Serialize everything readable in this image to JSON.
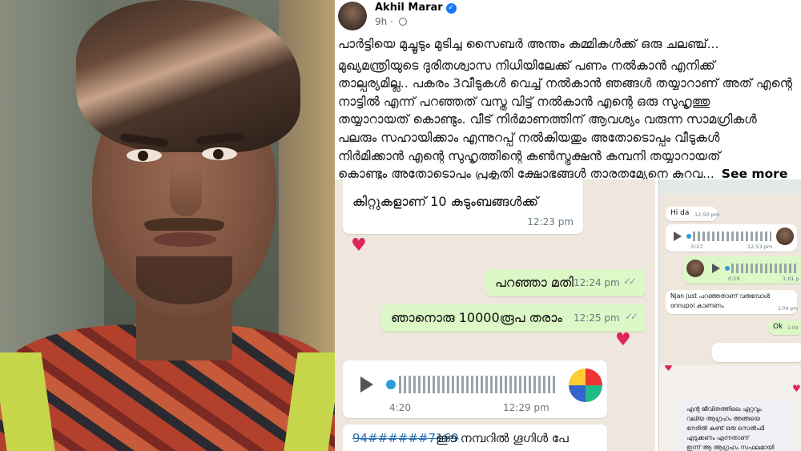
{
  "post": {
    "author": "Akhil Marar",
    "time": "9h",
    "see_more": "See more",
    "lines": [
      "പാർട്ടിയെ മുച്ചൂടും മുടിച്ച സൈബർ അന്തം കമ്മികൾക്ക് ഒരു ചലഞ്ച്...",
      "മുഖ്യമന്ത്രിയുടെ ദുരിതശ്വാസ നിധിയിലേക്ക് പണം നൽകാൻ എനിക്ക്",
      "താല്പര്യമില്ല.. പകരം 3വീടുകൾ വെച്ച് നൽകാൻ ഞങ്ങൾ തയ്യാറാണ് അത് എന്റെ",
      "നാട്ടിൽ എന്ന് പറഞ്ഞത് വസ്തു വിട്ട് നൽകാൻ എന്റെ ഒരു സുഹൃത്തു",
      "തയ്യാറായത് കൊണ്ടും. വീട് നിർമാണത്തിന് ആവശ്യം വരുന്ന സാമഗ്രികൾ",
      "പലരും സഹായിക്കാം എന്നുറപ്പ് നൽകിയതും അതോടൊപ്പം വീടുകൾ",
      "നിർമിക്കാൻ എന്റെ സുഹൃത്തിന്റെ കൺസ്ട്രക്ഷൻ കമ്പനി തയ്യാറായത്",
      "കൊണ്ടും അതോടൊപ്പം പ്രകൃതി ക്ഷോഭങ്ങൾ താരതമ്യേനെ കുറവ..."
    ]
  },
  "chat1": {
    "msg1": "കിറ്റുകളാണ് 10 കുടുംബങ്ങൾക്ക്",
    "msg1_time": "12:23 pm",
    "msg2": "പറഞ്ഞാ മതി",
    "msg2_time": "12:24 pm",
    "msg3": "ഞാനൊരു 10000രൂപ തരാം",
    "msg3_time": "12:25 pm",
    "voice_duration": "4:20",
    "voice_time": "12:29 pm",
    "msg4_number": "94######7169",
    "msg4": "ഈ നമ്പറിൽ ഗൂഗിൾ പേ",
    "ticks": "✓✓",
    "heart": "♥"
  },
  "chat2": {
    "msg1": "Hi da",
    "msg1_time": "12:50 pm",
    "voice1_duration": "0:27",
    "voice1_time": "12:53 pm",
    "voice2_duration": "0:19",
    "voice2_time": "1:01 p",
    "msg3": "Njan just പറഞ്ഞതാണ് വരുമ്പോൾ",
    "msg3b": "onnupoi കാണണം",
    "msg3_time": "1:04 pm",
    "msg4": "Ok",
    "msg4_time": "1:04"
  },
  "chat3": {
    "line1": "എന്റ ജീവിതത്തിലെ ഏറ്റവും",
    "line2": "വലിയ ആഗ്രഹം അങ്ങയെ",
    "line3": "നേരിൽ കണ്ട് ഒരു സെൽഫി",
    "line4": "എടുക്കണം എന്നതാണ്",
    "line5": "ഇന്ന് ആ ആഗ്രഹം സഫലമായി"
  },
  "colors": {
    "chat_bg": "#efe7de",
    "outgoing_bubble": "#dcf8c6",
    "verified": "#1877f2",
    "heart": "#e0245e"
  }
}
